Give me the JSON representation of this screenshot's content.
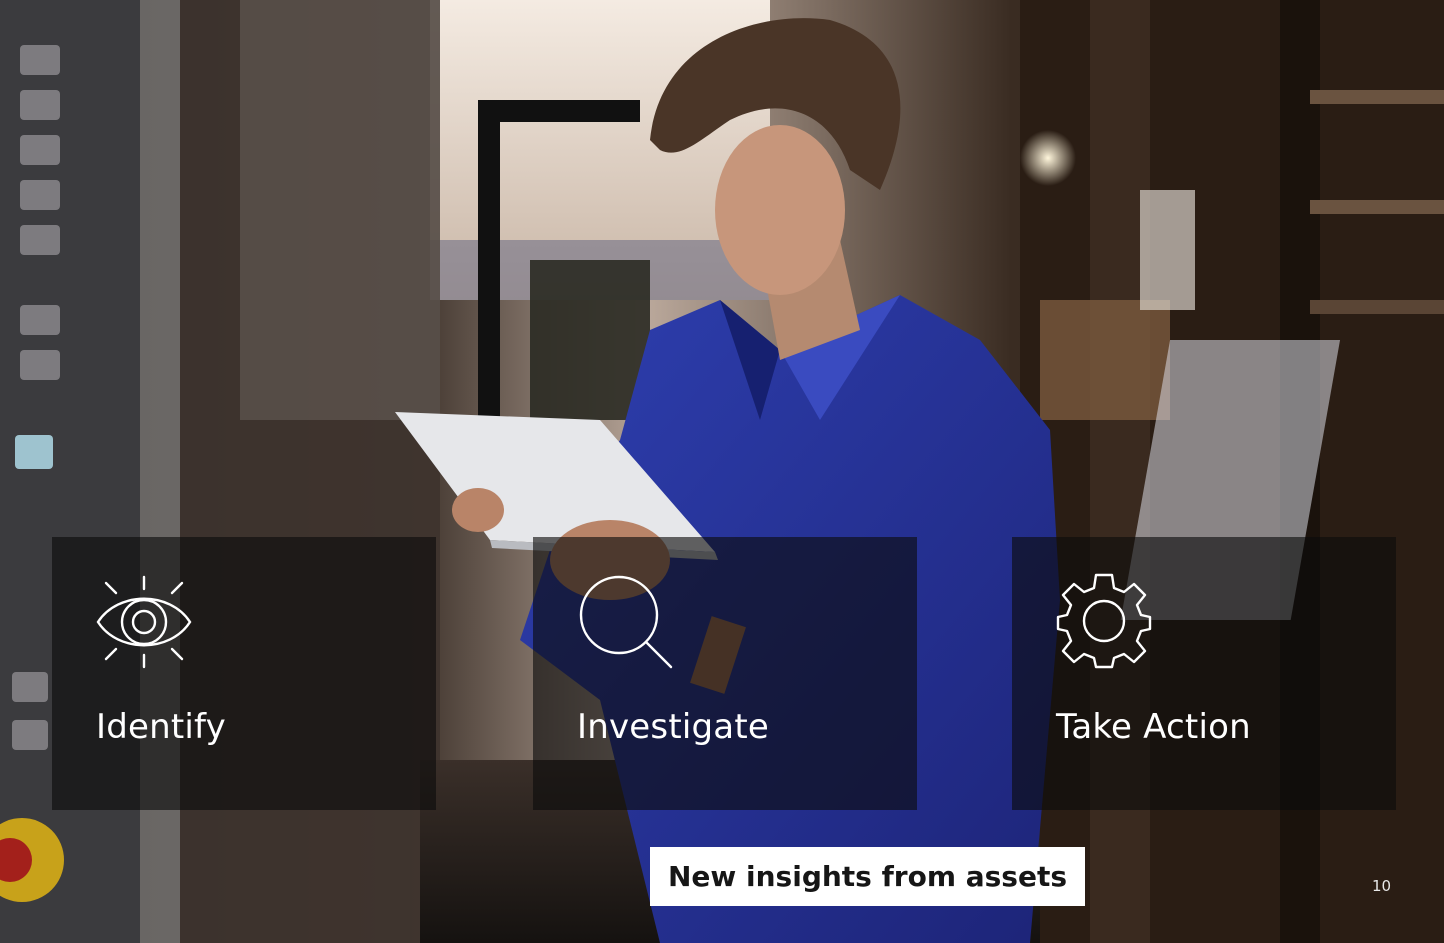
{
  "cards": [
    {
      "icon": "eye-icon",
      "label": "Identify"
    },
    {
      "icon": "magnifier-icon",
      "label": "Investigate"
    },
    {
      "icon": "gear-icon",
      "label": "Take Action"
    }
  ],
  "caption": "New insights from assets",
  "page_number": "10",
  "colors": {
    "overlay": "#0c0c0c",
    "caption_bg": "#ffffff",
    "caption_text": "#161616",
    "text": "#ffffff"
  }
}
